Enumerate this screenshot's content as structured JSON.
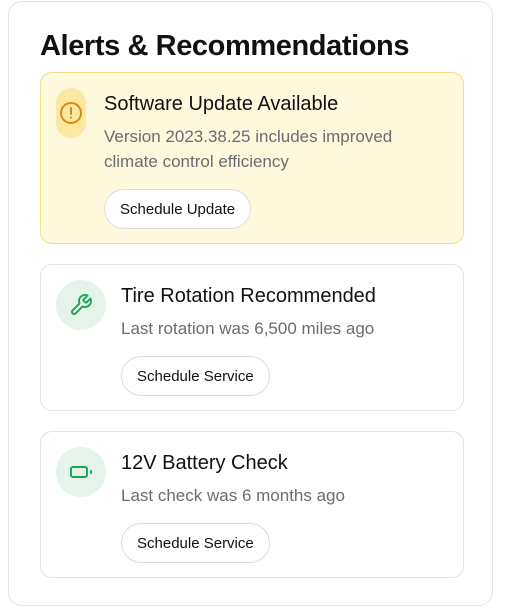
{
  "panel": {
    "title": "Alerts & Recommendations"
  },
  "alerts": [
    {
      "variant": "warning",
      "icon": "alert-circle-icon",
      "title": "Software Update Available",
      "description": "Version 2023.38.25 includes improved climate control efficiency",
      "action": "Schedule Update"
    },
    {
      "variant": "service",
      "icon": "wrench-icon",
      "title": "Tire Rotation Recommended",
      "description": "Last rotation was 6,500 miles ago",
      "action": "Schedule Service"
    },
    {
      "variant": "service",
      "icon": "battery-icon",
      "title": "12V Battery Check",
      "description": "Last check was 6 months ago",
      "action": "Schedule Service"
    }
  ],
  "colors": {
    "warning_bg": "#fef9dc",
    "warning_border": "#f3dd8a",
    "warning_icon": "#d98a0b",
    "success_icon": "#22a55a",
    "success_icon_bg": "#e5f4ea"
  }
}
